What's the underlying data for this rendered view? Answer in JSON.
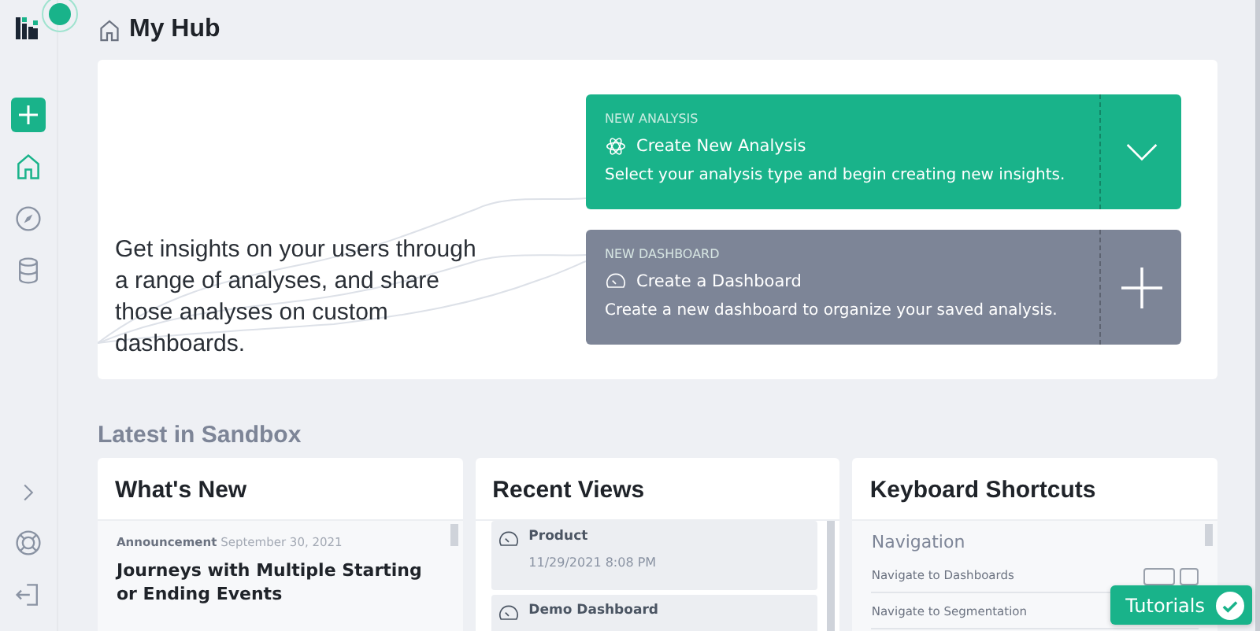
{
  "page": {
    "title": "My Hub"
  },
  "hero": {
    "text": "Get insights on your users through a range of analyses, and share those analyses on custom dashboards.",
    "actions": [
      {
        "kind": "analysis",
        "eyebrow": "NEW ANALYSIS",
        "title": "Create New Analysis",
        "description": "Select your analysis type and begin creating new insights."
      },
      {
        "kind": "dashboard",
        "eyebrow": "NEW DASHBOARD",
        "title": "Create a Dashboard",
        "description": "Create a new dashboard to organize your saved analysis."
      }
    ]
  },
  "section_title": "Latest in Sandbox",
  "whats_new": {
    "title": "What's New",
    "items": [
      {
        "tag": "Announcement",
        "date": "September 30, 2021",
        "headline": "Journeys with Multiple Starting or Ending Events"
      }
    ]
  },
  "recent_views": {
    "title": "Recent Views",
    "items": [
      {
        "name": "Product",
        "time": "11/29/2021 8:08 PM"
      },
      {
        "name": "Demo Dashboard"
      }
    ]
  },
  "shortcuts": {
    "title": "Keyboard Shortcuts",
    "group": "Navigation",
    "items": [
      "Navigate to Dashboards",
      "Navigate to Segmentation"
    ]
  },
  "tutorials": {
    "label": "Tutorials",
    "done": true
  }
}
